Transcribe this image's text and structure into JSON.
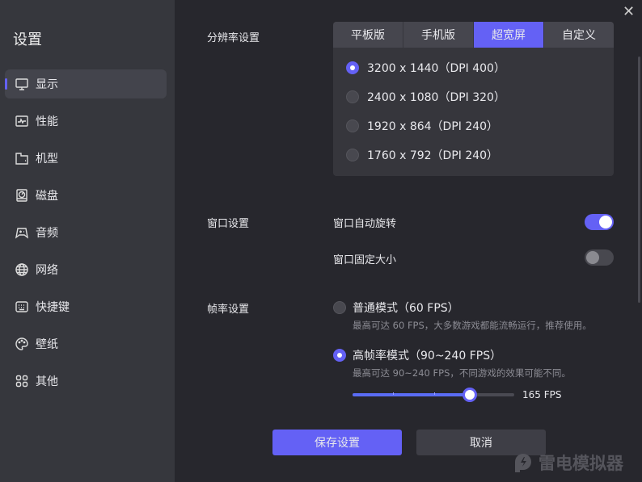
{
  "sidebar": {
    "title": "设置",
    "items": [
      {
        "label": "显示",
        "icon": "monitor-icon"
      },
      {
        "label": "性能",
        "icon": "pulse-icon"
      },
      {
        "label": "机型",
        "icon": "device-icon"
      },
      {
        "label": "磁盘",
        "icon": "disk-icon"
      },
      {
        "label": "音频",
        "icon": "gamepad-icon"
      },
      {
        "label": "网络",
        "icon": "globe-icon"
      },
      {
        "label": "快捷键",
        "icon": "keyboard-icon"
      },
      {
        "label": "壁纸",
        "icon": "palette-icon"
      },
      {
        "label": "其他",
        "icon": "grid-icon"
      }
    ]
  },
  "resolution": {
    "label": "分辨率设置",
    "tabs": [
      "平板版",
      "手机版",
      "超宽屏",
      "自定义"
    ],
    "active_tab": 2,
    "options": [
      "3200 x 1440（DPI 400）",
      "2400 x 1080（DPI 320）",
      "1920 x 864（DPI 240）",
      "1760 x 792（DPI 240）"
    ],
    "selected": 0
  },
  "window": {
    "label": "窗口设置",
    "auto_rotate": {
      "label": "窗口自动旋转",
      "on": true
    },
    "fixed_size": {
      "label": "窗口固定大小",
      "on": false
    }
  },
  "framerate": {
    "label": "帧率设置",
    "normal": {
      "label": "普通模式（60 FPS）",
      "hint": "最高可达 60 FPS，大多数游戏都能流畅运行，推荐使用。",
      "selected": false
    },
    "high": {
      "label": "高帧率模式（90~240 FPS）",
      "hint": "最高可达 90~240 FPS，不同游戏的效果可能不同。",
      "selected": true
    },
    "slider": {
      "value_label": "165 FPS",
      "fraction": 0.725
    }
  },
  "buttons": {
    "save": "保存设置",
    "cancel": "取消"
  },
  "logo": "雷电模拟器",
  "colors": {
    "accent": "#6461f5",
    "sidebar": "#36373d",
    "background": "#27272d"
  }
}
